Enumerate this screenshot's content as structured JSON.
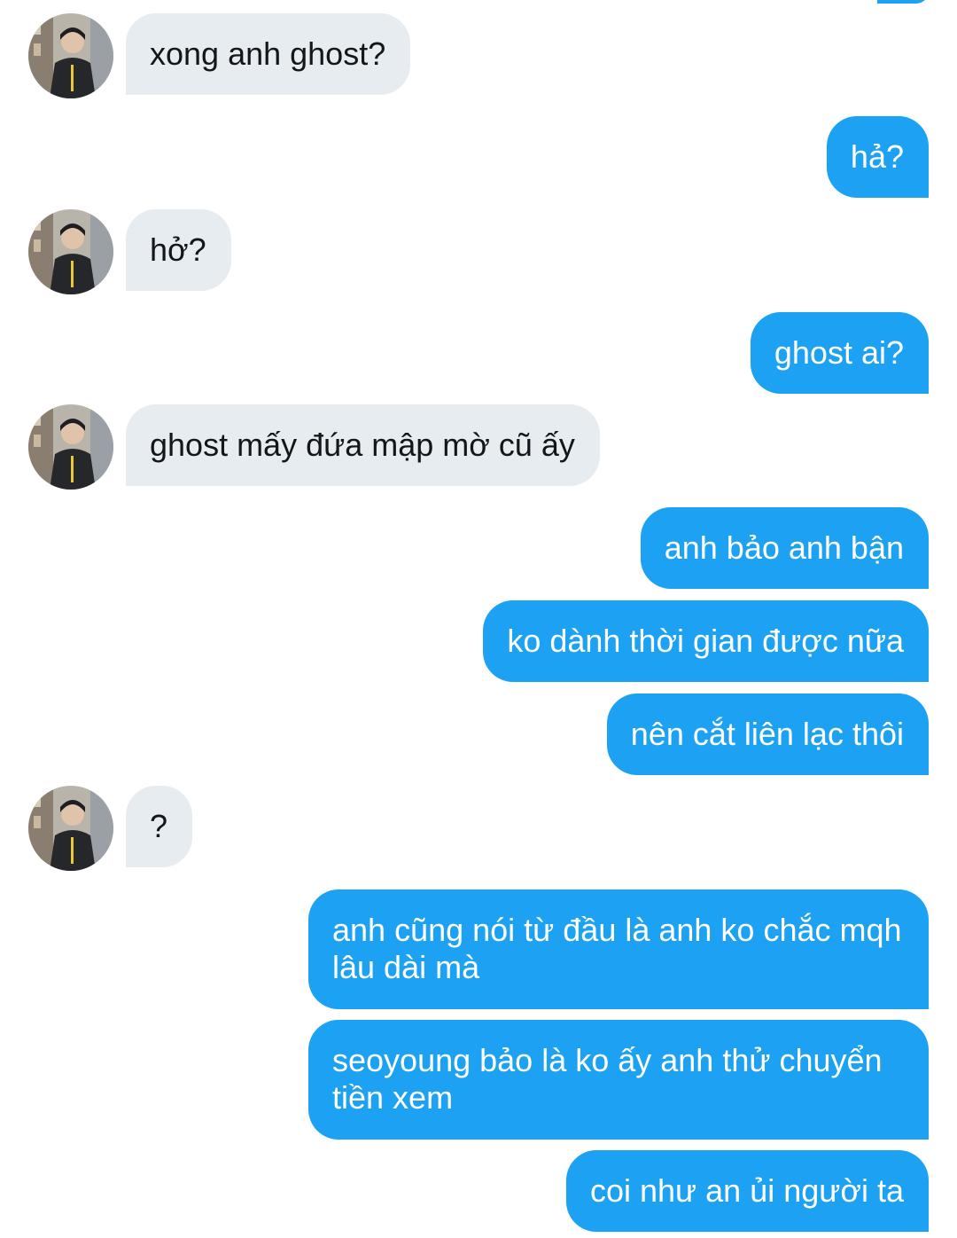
{
  "conversation": {
    "messages": [
      {
        "side": "incoming",
        "text": "xong anh ghost?"
      },
      {
        "side": "outgoing",
        "text": "hả?"
      },
      {
        "side": "incoming",
        "text": "hở?"
      },
      {
        "side": "outgoing",
        "text": "ghost ai?"
      },
      {
        "side": "incoming",
        "text": "ghost mấy đứa mập mờ cũ ấy"
      },
      {
        "side": "outgoing",
        "text": "anh bảo anh bận"
      },
      {
        "side": "outgoing",
        "text": "ko dành thời gian được nữa"
      },
      {
        "side": "outgoing",
        "text": "nên cắt liên lạc thôi"
      },
      {
        "side": "incoming",
        "text": "?"
      },
      {
        "side": "outgoing",
        "text": "anh cũng nói từ đầu là anh ko chắc mqh lâu dài mà"
      },
      {
        "side": "outgoing",
        "text": "seoyoung bảo là ko ấy anh thử chuyển tiền xem"
      },
      {
        "side": "outgoing",
        "text": "coi như an ủi người ta"
      }
    ]
  },
  "colors": {
    "outgoing_bubble": "#1da1f2",
    "incoming_bubble": "#e6ecf0",
    "incoming_text": "#14171a",
    "outgoing_text": "#ffffff"
  },
  "icons": {
    "avatar": "contact-avatar-photo"
  }
}
